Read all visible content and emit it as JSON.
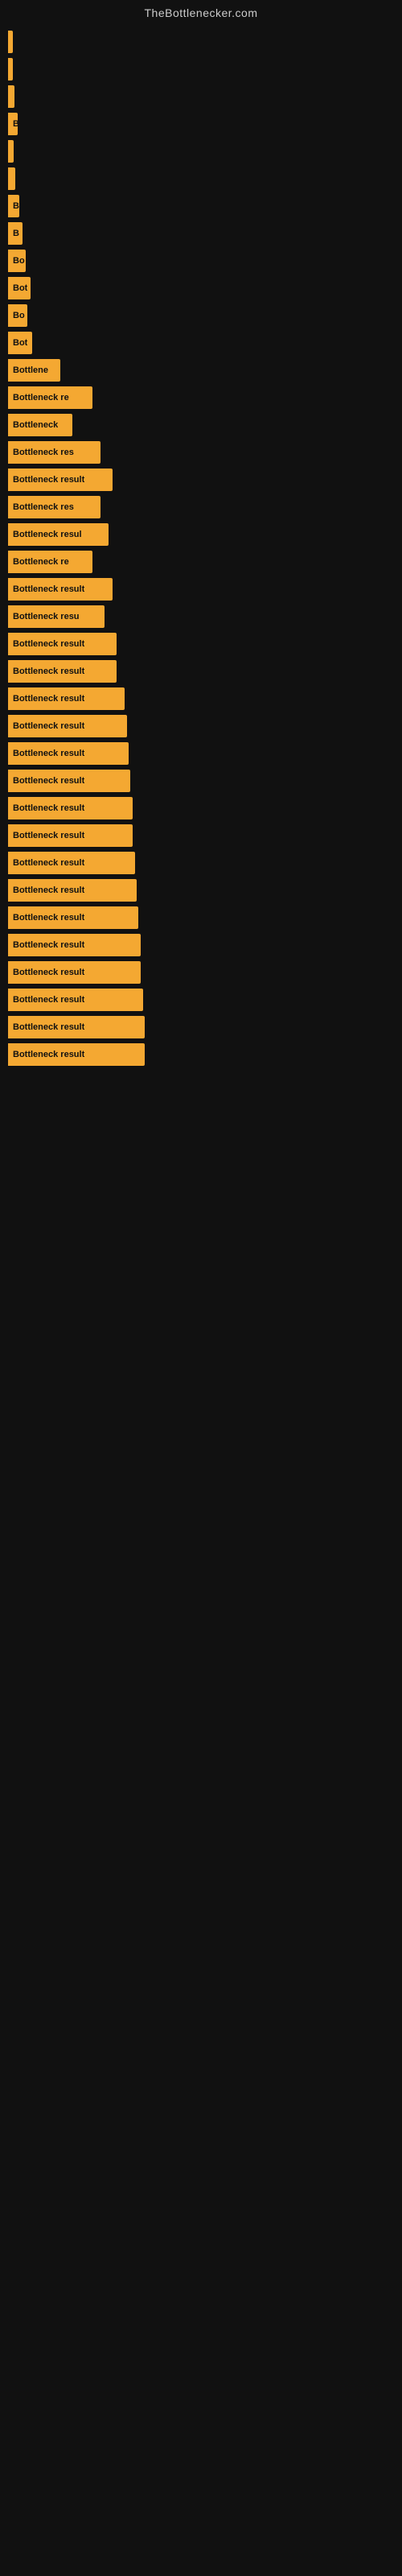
{
  "site": {
    "title": "TheBottlenecker.com"
  },
  "bars": [
    {
      "label": "",
      "width": 4
    },
    {
      "label": "",
      "width": 6
    },
    {
      "label": "",
      "width": 8
    },
    {
      "label": "B",
      "width": 12
    },
    {
      "label": "",
      "width": 7
    },
    {
      "label": "",
      "width": 9
    },
    {
      "label": "B",
      "width": 14
    },
    {
      "label": "B",
      "width": 18
    },
    {
      "label": "Bo",
      "width": 22
    },
    {
      "label": "Bot",
      "width": 28
    },
    {
      "label": "Bo",
      "width": 24
    },
    {
      "label": "Bot",
      "width": 30
    },
    {
      "label": "Bottlene",
      "width": 65
    },
    {
      "label": "Bottleneck re",
      "width": 105
    },
    {
      "label": "Bottleneck",
      "width": 80
    },
    {
      "label": "Bottleneck res",
      "width": 115
    },
    {
      "label": "Bottleneck result",
      "width": 130
    },
    {
      "label": "Bottleneck res",
      "width": 115
    },
    {
      "label": "Bottleneck resul",
      "width": 125
    },
    {
      "label": "Bottleneck re",
      "width": 105
    },
    {
      "label": "Bottleneck result",
      "width": 130
    },
    {
      "label": "Bottleneck resu",
      "width": 120
    },
    {
      "label": "Bottleneck result",
      "width": 135
    },
    {
      "label": "Bottleneck result",
      "width": 135
    },
    {
      "label": "Bottleneck result",
      "width": 145
    },
    {
      "label": "Bottleneck result",
      "width": 148
    },
    {
      "label": "Bottleneck result",
      "width": 150
    },
    {
      "label": "Bottleneck result",
      "width": 152
    },
    {
      "label": "Bottleneck result",
      "width": 155
    },
    {
      "label": "Bottleneck result",
      "width": 155
    },
    {
      "label": "Bottleneck result",
      "width": 158
    },
    {
      "label": "Bottleneck result",
      "width": 160
    },
    {
      "label": "Bottleneck result",
      "width": 162
    },
    {
      "label": "Bottleneck result",
      "width": 165
    },
    {
      "label": "Bottleneck result",
      "width": 165
    },
    {
      "label": "Bottleneck result",
      "width": 168
    },
    {
      "label": "Bottleneck result",
      "width": 170
    },
    {
      "label": "Bottleneck result",
      "width": 170
    }
  ]
}
